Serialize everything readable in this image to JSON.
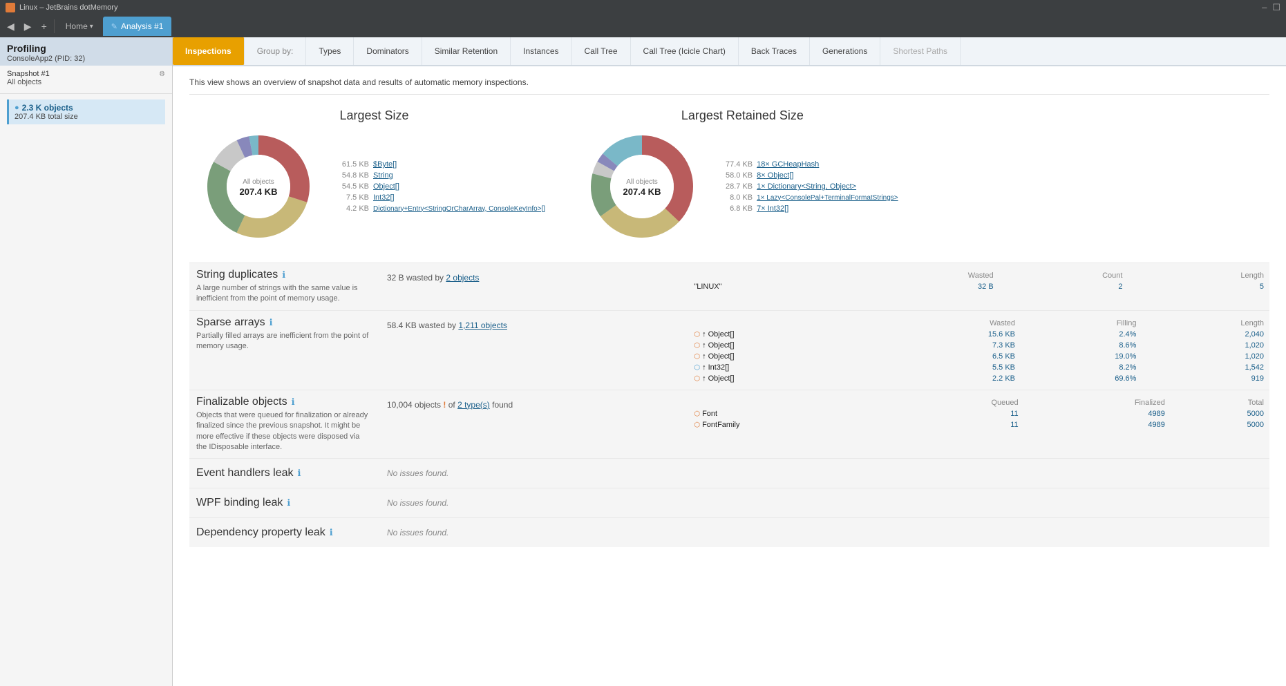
{
  "titleBar": {
    "title": "Linux – JetBrains dotMemory",
    "controls": [
      "–",
      "☐"
    ]
  },
  "navBar": {
    "backBtn": "◀",
    "forwardBtn": "▶",
    "addBtn": "+",
    "tabs": [
      {
        "label": "Home",
        "active": false,
        "hasDropdown": true
      },
      {
        "label": "Analysis #1",
        "active": true,
        "hasIcon": true
      }
    ]
  },
  "sidebar": {
    "profiling_label": "Profiling",
    "app_name": "ConsoleApp2 (PID: 32)",
    "snapshot_label": "Snapshot #1",
    "all_objects_label": "All objects",
    "object": {
      "count": "2.3 K objects",
      "size": "207.4 KB  total size"
    }
  },
  "tabs": [
    {
      "label": "Inspections",
      "active": true
    },
    {
      "label": "Group by:"
    },
    {
      "label": "Types"
    },
    {
      "label": "Dominators"
    },
    {
      "label": "Similar Retention"
    },
    {
      "label": "Instances"
    },
    {
      "label": "Call Tree"
    },
    {
      "label": "Call Tree (Icicle Chart)"
    },
    {
      "label": "Back Traces"
    },
    {
      "label": "Generations"
    },
    {
      "label": "Shortest Paths"
    }
  ],
  "overview_text": "This view shows an overview of snapshot data and results of automatic memory inspections.",
  "largestSize": {
    "title": "Largest Size",
    "center_title": "All objects",
    "center_value": "207.4 KB",
    "items": [
      {
        "size": "61.5 KB",
        "name": "$Byte[]"
      },
      {
        "size": "54.8 KB",
        "name": "String"
      },
      {
        "size": "54.5 KB",
        "name": "Object[]"
      },
      {
        "size": "7.5 KB",
        "name": "Int32[]"
      },
      {
        "size": "4.2 KB",
        "name": "Dictionary+Entry<StringOrCharArray, ConsoleKeyInfo>[]"
      }
    ],
    "donut": {
      "segments": [
        {
          "color": "#b85c5c",
          "percent": 30
        },
        {
          "color": "#c8b878",
          "percent": 27
        },
        {
          "color": "#7a9e7a",
          "percent": 26
        },
        {
          "color": "#c8c8c8",
          "percent": 10
        },
        {
          "color": "#8888bb",
          "percent": 4
        },
        {
          "color": "#7ab8c8",
          "percent": 3
        }
      ]
    }
  },
  "largestRetainedSize": {
    "title": "Largest Retained Size",
    "center_title": "All objects",
    "center_value": "207.4 KB",
    "items": [
      {
        "size": "77.4 KB",
        "name": "18× GCHeapHash"
      },
      {
        "size": "58.0 KB",
        "name": "8× Object[]"
      },
      {
        "size": "28.7 KB",
        "name": "1× Dictionary<String, Object>"
      },
      {
        "size": "8.0 KB",
        "name": "1× Lazy<ConsolePal+TerminalFormatStrings>"
      },
      {
        "size": "6.8 KB",
        "name": "7× Int32[]"
      }
    ],
    "donut": {
      "segments": [
        {
          "color": "#b85c5c",
          "percent": 37
        },
        {
          "color": "#c8b878",
          "percent": 28
        },
        {
          "color": "#7a9e7a",
          "percent": 14
        },
        {
          "color": "#c8c8c8",
          "percent": 4
        },
        {
          "color": "#8888bb",
          "percent": 3
        },
        {
          "color": "#7ab8c8",
          "percent": 14
        }
      ]
    }
  },
  "stringDuplicates": {
    "title": "String duplicates",
    "desc": "A large number of strings with the same value is inefficient from the point of memory usage.",
    "summary_prefix": "32 B wasted by ",
    "summary_link": "2 objects",
    "headers": [
      "Wasted",
      "Count",
      "Length"
    ],
    "rows": [
      {
        "name": "\"LINUX\"",
        "wasted": "32 B",
        "count": "2",
        "length": "5"
      }
    ]
  },
  "sparseArrays": {
    "title": "Sparse arrays",
    "desc": "Partially filled arrays are inefficient from the point of memory usage.",
    "summary_prefix": "58.4 KB wasted by ",
    "summary_link": "1,211 objects",
    "headers": [
      "Wasted",
      "Filling",
      "Length"
    ],
    "rows": [
      {
        "icon": "orange",
        "name": "↑ Object[]",
        "wasted": "15.6 KB",
        "filling": "2.4%",
        "length": "2,040"
      },
      {
        "icon": "orange",
        "name": "↑ Object[]",
        "wasted": "7.3 KB",
        "filling": "8.6%",
        "length": "1,020"
      },
      {
        "icon": "orange",
        "name": "↑ Object[]",
        "wasted": "6.5 KB",
        "filling": "19.0%",
        "length": "1,020"
      },
      {
        "icon": "blue",
        "name": "↑ Int32[]",
        "wasted": "5.5 KB",
        "filling": "8.2%",
        "length": "1,542"
      },
      {
        "icon": "orange",
        "name": "↑ Object[]",
        "wasted": "2.2 KB",
        "filling": "69.6%",
        "length": "919"
      }
    ]
  },
  "finalizableObjects": {
    "title": "Finalizable objects",
    "desc": "Objects that were queued for finalization or already finalized since the previous snapshot. It might be more effective if these objects were disposed via the IDisposable interface.",
    "summary_prefix": "10,004 objects ",
    "summary_warn": "!",
    "summary_mid": " of ",
    "summary_link": "2 type(s)",
    "summary_suffix": " found",
    "headers": [
      "Queued",
      "Finalized",
      "Total"
    ],
    "rows": [
      {
        "icon": "orange",
        "name": "Font",
        "queued": "11",
        "finalized": "4989",
        "total": "5000"
      },
      {
        "icon": "orange",
        "name": "FontFamily",
        "queued": "11",
        "finalized": "4989",
        "total": "5000"
      }
    ]
  },
  "eventHandlersLeak": {
    "title": "Event handlers leak",
    "no_issues": "No issues found."
  },
  "wpfBindingLeak": {
    "title": "WPF binding leak",
    "no_issues": "No issues found."
  },
  "dependencyPropertyLeak": {
    "title": "Dependency property leak",
    "no_issues": "No issues found."
  }
}
